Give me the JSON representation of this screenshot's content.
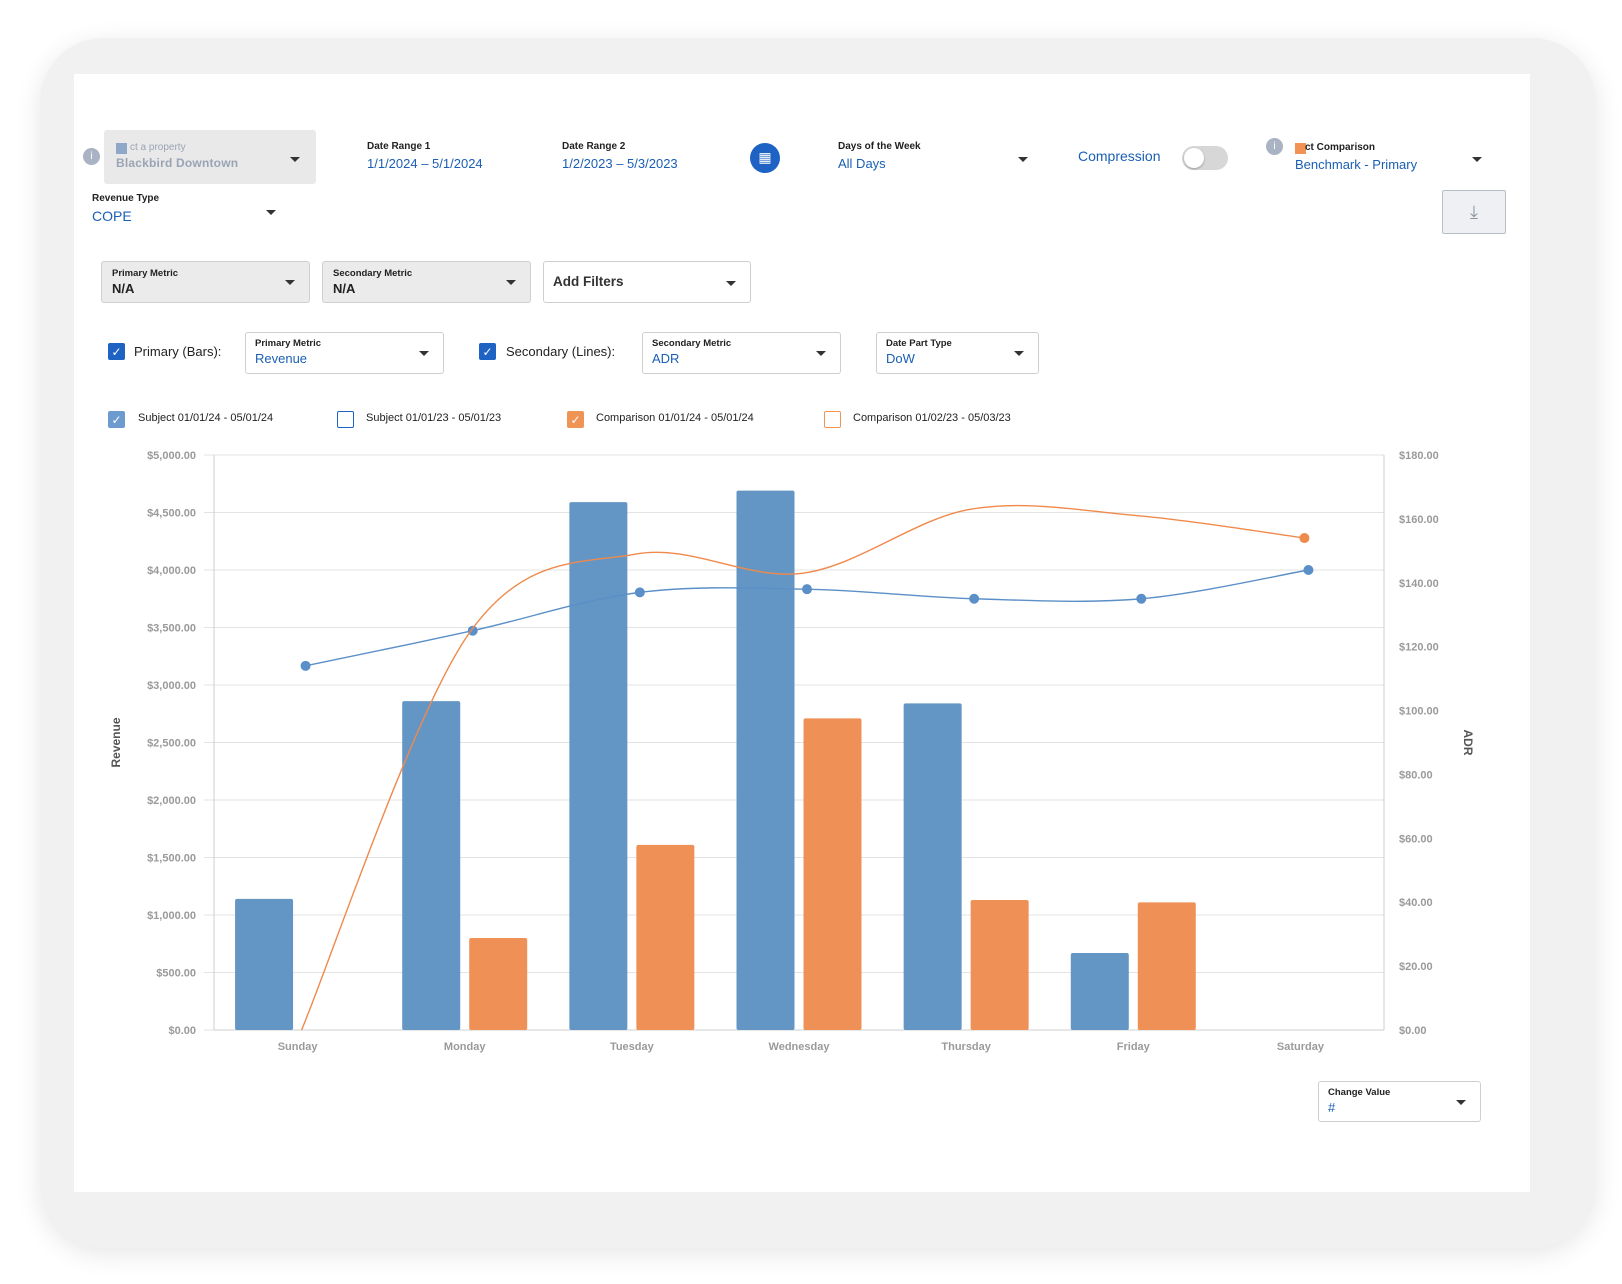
{
  "filters": {
    "property": {
      "placeholder": "ct a property",
      "value": "Blackbird Downtown"
    },
    "date_range_1": {
      "label": "Date Range 1",
      "value": "1/1/2024 – 5/1/2024"
    },
    "date_range_2": {
      "label": "Date Range 2",
      "value": "1/2/2023 – 5/3/2023"
    },
    "days_of_week": {
      "label": "Days of the Week",
      "value": "All Days"
    },
    "compression": {
      "label": "Compression",
      "on": false
    },
    "comparison": {
      "label": "ct Comparison",
      "value": "Benchmark - Primary"
    },
    "revenue_type": {
      "label": "Revenue Type",
      "value": "COPE"
    }
  },
  "metrics_row": {
    "primary": {
      "label": "Primary Metric",
      "value": "N/A"
    },
    "secondary": {
      "label": "Secondary Metric",
      "value": "N/A"
    },
    "add_filters": "Add Filters"
  },
  "series_row": {
    "primary_check_label": "Primary (Bars):",
    "primary_metric": {
      "label": "Primary Metric",
      "value": "Revenue"
    },
    "secondary_check_label": "Secondary (Lines):",
    "secondary_metric": {
      "label": "Secondary Metric",
      "value": "ADR"
    },
    "date_part": {
      "label": "Date Part Type",
      "value": "DoW"
    }
  },
  "legend": [
    {
      "label": "Subject 01/01/24 - 05/01/24",
      "checked": true,
      "color": "#6d9bd0"
    },
    {
      "label": "Subject 01/01/23 - 05/01/23",
      "checked": false,
      "color": "#1e63c4"
    },
    {
      "label": "Comparison 01/01/24 - 05/01/24",
      "checked": true,
      "color": "#f09456"
    },
    {
      "label": "Comparison 01/02/23 - 05/03/23",
      "checked": false,
      "color": "#f09456"
    }
  ],
  "change_value": {
    "label": "Change Value",
    "value": "#"
  },
  "chart_data": {
    "type": "bar",
    "categories": [
      "Sunday",
      "Monday",
      "Tuesday",
      "Wednesday",
      "Thursday",
      "Friday",
      "Saturday"
    ],
    "ylabel": "Revenue",
    "y2label": "ADR",
    "ylim": [
      0,
      5000
    ],
    "y2lim": [
      0,
      180
    ],
    "yticks": [
      "$0.00",
      "$500.00",
      "$1,000.00",
      "$1,500.00",
      "$2,000.00",
      "$2,500.00",
      "$3,000.00",
      "$3,500.00",
      "$4,000.00",
      "$4,500.00",
      "$5,000.00"
    ],
    "y2ticks": [
      "$0.00",
      "$20.00",
      "$40.00",
      "$60.00",
      "$80.00",
      "$100.00",
      "$120.00",
      "$140.00",
      "$160.00",
      "$180.00"
    ],
    "grid": true,
    "bar_series": [
      {
        "color": "#6396c4",
        "values": [
          1140,
          2860,
          4590,
          4690,
          2840,
          670,
          null
        ]
      },
      {
        "color": "#ef9157",
        "values": [
          null,
          800,
          1610,
          2710,
          1130,
          1110,
          null
        ]
      }
    ],
    "line_series": [
      {
        "color": "#5b8fc8",
        "values": [
          114,
          125,
          137,
          138,
          135,
          135,
          144
        ]
      },
      {
        "color": "#ef8a4c",
        "values": [
          0,
          124,
          149,
          143,
          163,
          161,
          154
        ]
      }
    ]
  }
}
